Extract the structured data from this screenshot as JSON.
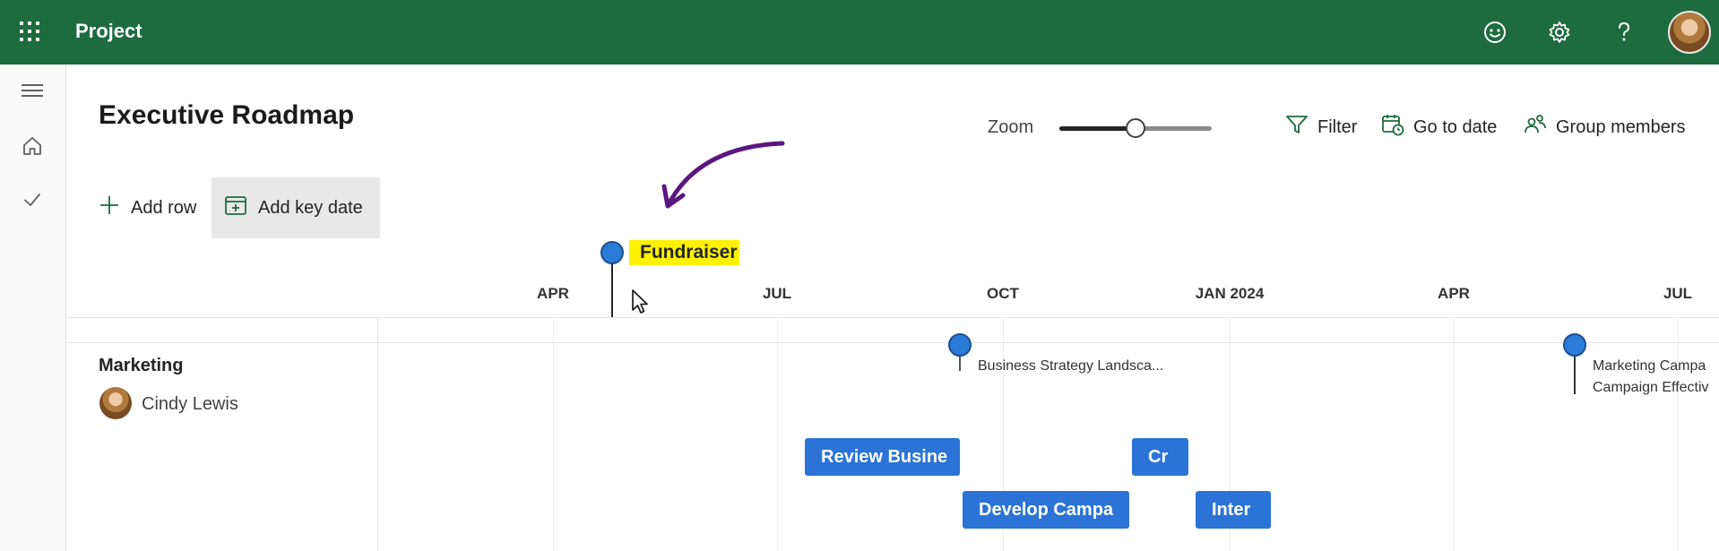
{
  "app": {
    "title": "Project"
  },
  "page": {
    "title": "Executive Roadmap"
  },
  "header": {
    "zoom_label": "Zoom",
    "zoom_level": 0.5,
    "filter_label": "Filter",
    "go_to_date_label": "Go to date",
    "group_members_label": "Group members"
  },
  "toolbar": {
    "add_row_label": "Add row",
    "add_key_date_label": "Add key date"
  },
  "timeline": {
    "months": [
      "APR",
      "JUL",
      "OCT",
      "JAN 2024",
      "APR",
      "JUL"
    ],
    "fundraiser_label": "Fundraiser"
  },
  "rows": [
    {
      "title": "Marketing",
      "owner": "Cindy Lewis",
      "key_dates": [
        {
          "label": "Business Strategy Landsca...",
          "label2": ""
        },
        {
          "label": "Marketing Campa",
          "label2": "Campaign Effectiv"
        }
      ],
      "bars": [
        {
          "label": "Review Busine"
        },
        {
          "label": "Cr"
        },
        {
          "label": "Develop Campa"
        },
        {
          "label": "Inter"
        }
      ]
    }
  ],
  "colors": {
    "topbar": "#1e6b3f",
    "bar": "#2b73d6",
    "pin": "#2b7bd8",
    "highlight": "#fff200",
    "annotation": "#5b1780"
  },
  "icons": {
    "app_launcher": "waffle-icon",
    "feedback": "smiley-icon",
    "settings": "gear-icon",
    "help": "question-icon",
    "menu": "hamburger-icon",
    "home": "home-icon",
    "tasks": "check-icon",
    "filter": "filter-icon",
    "go_to_date": "calendar-clock-icon",
    "group_members": "people-icon",
    "add": "plus-icon",
    "add_key_date": "calendar-add-icon"
  }
}
